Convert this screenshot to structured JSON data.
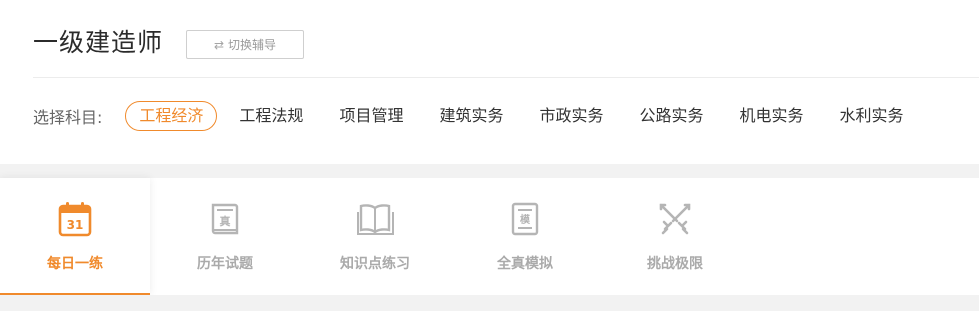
{
  "header": {
    "title": "一级建造师",
    "switch_label": "切换辅导"
  },
  "subjects": {
    "label": "选择科目:",
    "items": [
      "工程经济",
      "工程法规",
      "项目管理",
      "建筑实务",
      "市政实务",
      "公路实务",
      "机电实务",
      "水利实务"
    ],
    "active_index": 0
  },
  "tabs": [
    {
      "label": "每日一练",
      "icon": "calendar-icon",
      "icon_text": "31"
    },
    {
      "label": "历年试题",
      "icon": "book-icon",
      "icon_text": "真"
    },
    {
      "label": "知识点练习",
      "icon": "open-book-icon"
    },
    {
      "label": "全真模拟",
      "icon": "exam-paper-icon",
      "icon_text": "模"
    },
    {
      "label": "挑战极限",
      "icon": "crossed-swords-icon"
    }
  ],
  "colors": {
    "accent": "#f08a2c",
    "inactive": "#aaaaaa"
  }
}
